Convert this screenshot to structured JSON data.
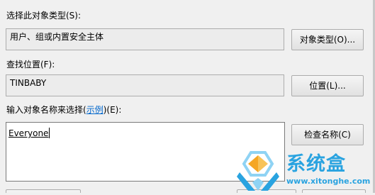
{
  "dialog": {
    "object_type": {
      "label": "选择此对象类型(S):",
      "value": "用户、组或内置安全主体",
      "button_label": "对象类型(O)..."
    },
    "location": {
      "label": "查找位置(F):",
      "value": "TINBABY",
      "button_label": "位置(L)..."
    },
    "object_names": {
      "label_prefix": "输入对象名称来选择(",
      "label_link": "示例",
      "label_suffix": ")(E):",
      "value": "Everyone",
      "button_label": "检查名称(C)"
    }
  },
  "watermark": {
    "logo_text": "系统盒",
    "url": "www.xitonghe.com",
    "icon": "xitonghe-logo-icon",
    "colors": {
      "blue": "#29a3e0",
      "orange": "#f5a623",
      "light_blue": "#8fd3f4"
    }
  }
}
